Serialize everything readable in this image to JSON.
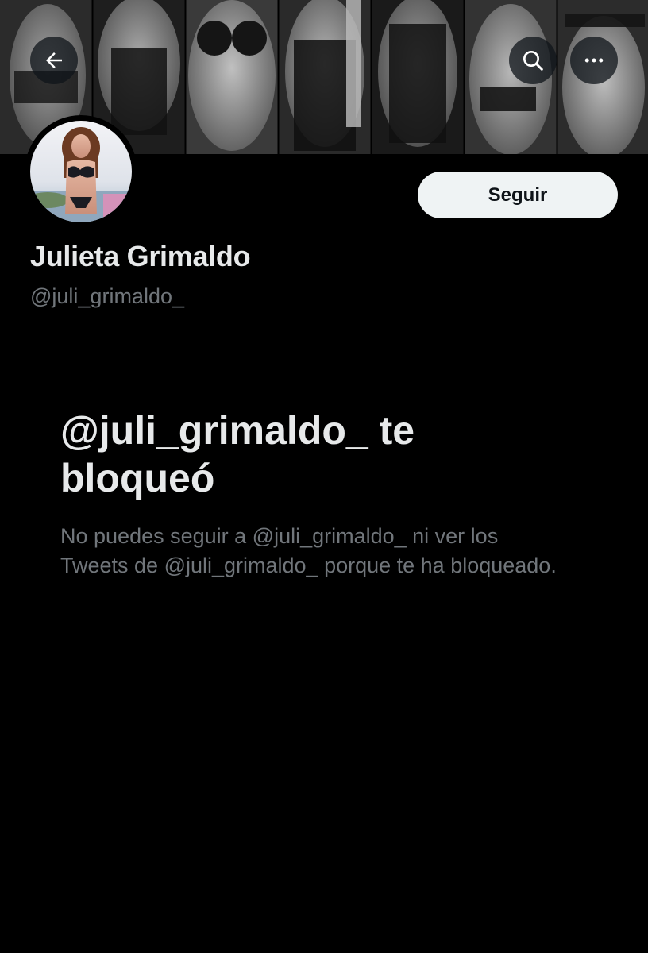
{
  "header": {
    "back_icon": "arrow-left-icon",
    "search_icon": "search-icon",
    "more_icon": "more-horizontal-icon"
  },
  "profile": {
    "display_name": "Julieta Grimaldo",
    "handle": "@juli_grimaldo_",
    "follow_label": "Seguir"
  },
  "blocked": {
    "title": "@juli_grimaldo_ te bloqueó",
    "description": "No puedes seguir a @juli_grimaldo_ ni ver los Tweets de @juli_grimaldo_ porque te ha bloqueado."
  },
  "colors": {
    "background": "#000000",
    "primary_text": "#e7e9ea",
    "secondary_text": "#71767b",
    "button_bg": "#eff3f4",
    "button_text": "#0f1419"
  }
}
